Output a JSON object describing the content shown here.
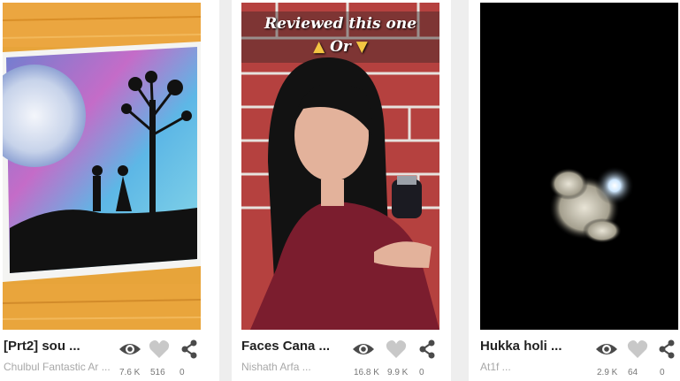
{
  "cards": [
    {
      "title": "[Prt2] sou ...",
      "author": "Chulbul Fantastic Ar ...",
      "views": "7.6 K",
      "likes": "516",
      "shares": "0",
      "icons": [
        "eye-icon",
        "heart-icon",
        "share-icon"
      ]
    },
    {
      "title": "Faces Cana ...",
      "author": "Nishath Arfa ...",
      "views": "16.8 K",
      "likes": "9.9 K",
      "shares": "0",
      "overlay_line1": "Reviewed this one",
      "overlay_line2": "Or",
      "icons": [
        "eye-icon",
        "heart-icon",
        "share-icon"
      ]
    },
    {
      "title": "Hukka holi ...",
      "author": "At1f ...",
      "views": "2.9 K",
      "likes": "64",
      "shares": "0",
      "icons": [
        "eye-icon",
        "heart-icon",
        "share-icon"
      ]
    }
  ],
  "colors": {
    "icon_gray": "#4a4a4a",
    "heart_gray": "#c8c8c8",
    "title_text": "#222222",
    "author_text": "#a8a8a8"
  }
}
